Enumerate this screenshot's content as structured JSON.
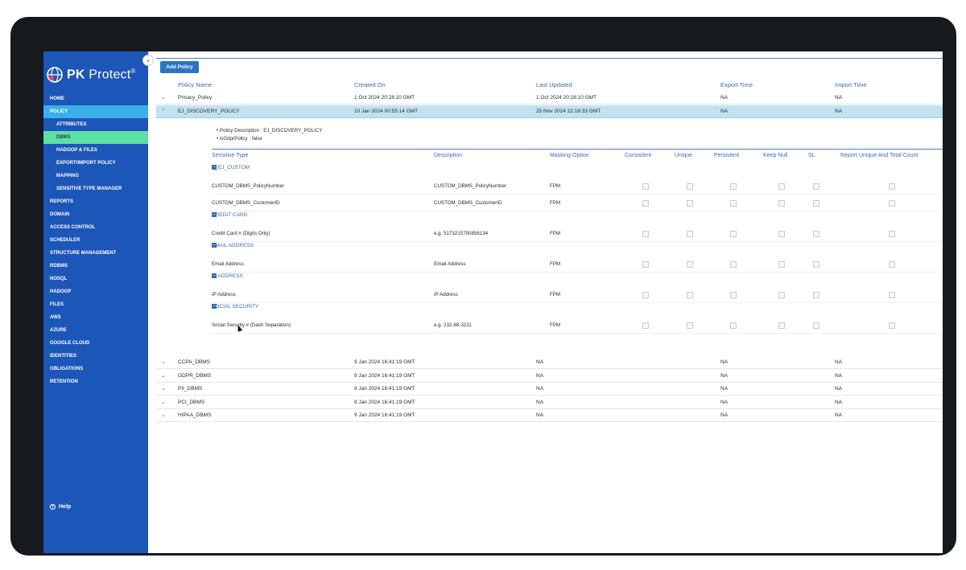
{
  "logo": {
    "brand": "PK",
    "product": "Protect",
    "reg": "®"
  },
  "sidebar": {
    "items": [
      {
        "label": "HOME",
        "sub": false,
        "state": ""
      },
      {
        "label": "POLICY",
        "sub": false,
        "state": "cyan"
      },
      {
        "label": "ATTRIBUTES",
        "sub": true,
        "state": ""
      },
      {
        "label": "DBMS",
        "sub": true,
        "state": "green"
      },
      {
        "label": "HADOOP & FILES",
        "sub": true,
        "state": ""
      },
      {
        "label": "EXPORT/IMPORT POLICY",
        "sub": true,
        "state": ""
      },
      {
        "label": "MAPPING",
        "sub": true,
        "state": ""
      },
      {
        "label": "SENSITIVE TYPE MANAGER",
        "sub": true,
        "state": ""
      },
      {
        "label": "REPORTS",
        "sub": false,
        "state": ""
      },
      {
        "label": "DOMAIN",
        "sub": false,
        "state": ""
      },
      {
        "label": "ACCESS CONTROL",
        "sub": false,
        "state": ""
      },
      {
        "label": "SCHEDULER",
        "sub": false,
        "state": ""
      },
      {
        "label": "STRUCTURE MANAGEMENT",
        "sub": false,
        "state": ""
      },
      {
        "label": "RDBMS",
        "sub": false,
        "state": ""
      },
      {
        "label": "NOSQL",
        "sub": false,
        "state": ""
      },
      {
        "label": "HADOOP",
        "sub": false,
        "state": ""
      },
      {
        "label": "FILES",
        "sub": false,
        "state": ""
      },
      {
        "label": "AWS",
        "sub": false,
        "state": ""
      },
      {
        "label": "AZURE",
        "sub": false,
        "state": ""
      },
      {
        "label": "GOOGLE CLOUD",
        "sub": false,
        "state": ""
      },
      {
        "label": "IDENTITIES",
        "sub": false,
        "state": ""
      },
      {
        "label": "OBLIGATIONS",
        "sub": false,
        "state": ""
      },
      {
        "label": "RETENTION",
        "sub": false,
        "state": ""
      }
    ],
    "help_label": "Help"
  },
  "toolbar": {
    "add_policy_label": "Add Policy"
  },
  "table": {
    "headers": {
      "policy_name": "Policy Name",
      "created_on": "Created On",
      "last_updated": "Last Updated",
      "export_time": "Export Time",
      "import_time": "Import Time"
    },
    "rows_top": [
      {
        "name": "Privacy_Policy",
        "created": "1 Oct 2024 20:28:10 GMT",
        "updated": "1 Oct 2024 20:28:10 GMT",
        "export": "NA",
        "import": "NA",
        "chevron": "⌄",
        "expanded": false
      },
      {
        "name": "EJ_DISCOVERY_POLICY",
        "created": "10 Jan 2024 00:55:14 GMT",
        "updated": "25 Nov 2024 22:18:33 GMT",
        "export": "NA",
        "import": "NA",
        "chevron": "⌃",
        "expanded": true
      }
    ],
    "rows_bottom": [
      {
        "name": "CCPA_DBMS",
        "created": "9 Jan 2024 16:41:19 GMT",
        "updated": "NA",
        "export": "NA",
        "import": "NA",
        "chevron": "⌄",
        "expanded": false
      },
      {
        "name": "GDPR_DBMS",
        "created": "9 Jan 2024 16:41:19 GMT",
        "updated": "NA",
        "export": "NA",
        "import": "NA",
        "chevron": "⌄",
        "expanded": false
      },
      {
        "name": "PII_DBMS",
        "created": "9 Jan 2024 16:41:19 GMT",
        "updated": "NA",
        "export": "NA",
        "import": "NA",
        "chevron": "⌄",
        "expanded": false
      },
      {
        "name": "PCI_DBMS",
        "created": "9 Jan 2024 16:41:19 GMT",
        "updated": "NA",
        "export": "NA",
        "import": "NA",
        "chevron": "⌄",
        "expanded": false
      },
      {
        "name": "HIPAA_DBMS",
        "created": "9 Jan 2024 16:41:19 GMT",
        "updated": "NA",
        "export": "NA",
        "import": "NA",
        "chevron": "⌄",
        "expanded": false
      }
    ]
  },
  "details": {
    "policy_description": "Policy Description : EJ_DISCOVERY_POLICY",
    "is_gdpr": "isGdprPolicy : false",
    "headers": {
      "sensitive_type": "Sensitive Type",
      "description": "Description",
      "masking_option": "Masking Option",
      "consistent": "Consistent",
      "unique": "Unique",
      "persistent": "Persistent",
      "keep_null": "Keep Null",
      "sl": "SL",
      "report": "Report Unique And Total Count"
    },
    "groups": [
      {
        "name": "A_EJ_CUSTOM",
        "rows": [
          {
            "type": "CUSTOM_DBMS_PolicyNumber",
            "description": "CUSTOM_DBMS_PolicyNumber",
            "masking": "FPM"
          },
          {
            "type": "CUSTOM_DBMS_CustomerID",
            "description": "CUSTOM_DBMS_CustomerID",
            "masking": "FPM"
          }
        ]
      },
      {
        "name": "CREDIT CARD",
        "rows": [
          {
            "type": "Credit Card # (Digits Only)",
            "description": "e.g. 5173215750856134",
            "masking": "FPM"
          }
        ]
      },
      {
        "name": "EMAIL ADDRESS",
        "rows": [
          {
            "type": "Email Address",
            "description": "Email Address",
            "masking": "FPM"
          }
        ]
      },
      {
        "name": "IP ADDRESS",
        "rows": [
          {
            "type": "IP Address",
            "description": "IP Address",
            "masking": "FPM"
          }
        ]
      },
      {
        "name": "SOCIAL SECURITY",
        "rows": [
          {
            "type": "Social Security # (Dash Separation)",
            "description": "e.g. 232-88-3211",
            "masking": "FPM"
          }
        ]
      }
    ]
  }
}
